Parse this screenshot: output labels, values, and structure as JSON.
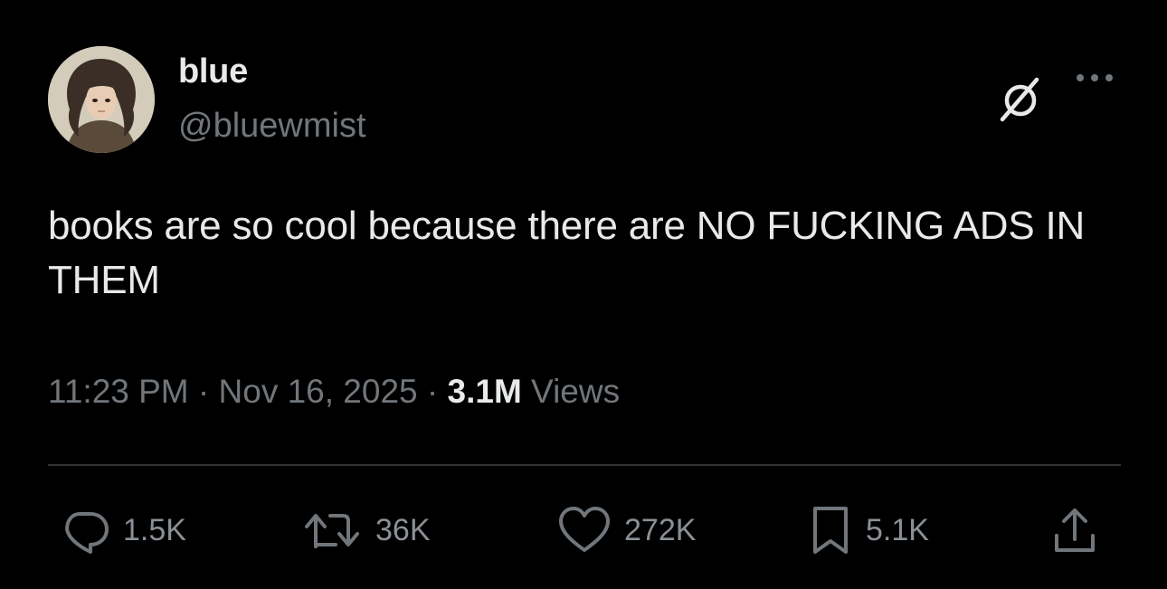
{
  "author": {
    "display_name": "blue",
    "handle": "@bluewmist"
  },
  "tweet": {
    "text": "books are so cool because there are NO FUCKING ADS IN THEM",
    "time": "11:23 PM",
    "separator": " · ",
    "date": "Nov 16, 2025",
    "views_count": "3.1M",
    "views_label": " Views"
  },
  "actions": {
    "replies": "1.5K",
    "reposts": "36K",
    "likes": "272K",
    "bookmarks": "5.1K"
  },
  "icons": {
    "grok": "grok-icon",
    "more": "more-icon",
    "reply": "reply-icon",
    "repost": "repost-icon",
    "like": "heart-icon",
    "bookmark": "bookmark-icon",
    "share": "share-icon"
  },
  "colors": {
    "background": "#000000",
    "primary_text": "#e7e9ea",
    "secondary_text": "#71767b",
    "divider": "#2f3336"
  }
}
